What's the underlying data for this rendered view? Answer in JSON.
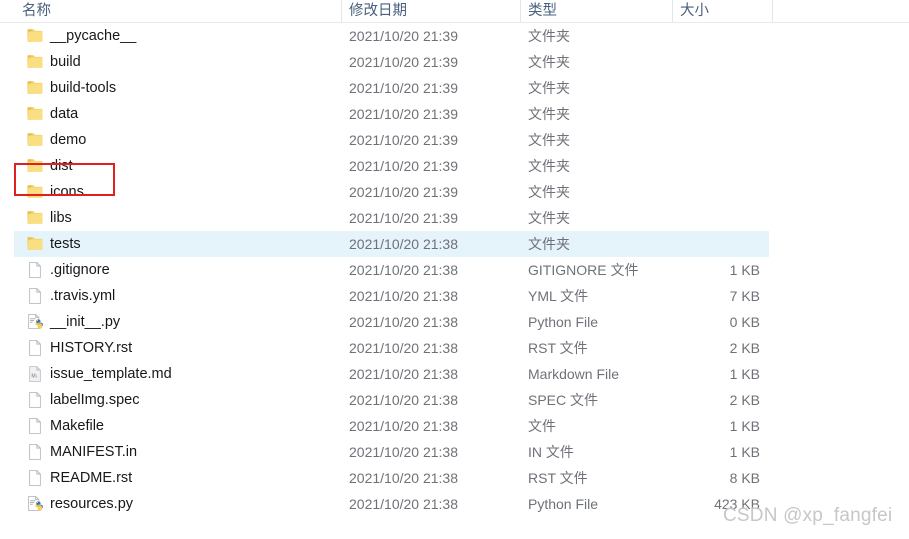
{
  "window": {
    "kind": "file-explorer-list-view",
    "language": "zh-CN"
  },
  "columns": [
    {
      "key": "name",
      "label": "名称"
    },
    {
      "key": "date",
      "label": "修改日期"
    },
    {
      "key": "type",
      "label": "类型"
    },
    {
      "key": "size",
      "label": "大小"
    }
  ],
  "rows": [
    {
      "name": "__pycache__",
      "date": "2021/10/20 21:39",
      "type": "文件夹",
      "size": "",
      "icon": "folder-icon",
      "selected": false
    },
    {
      "name": "build",
      "date": "2021/10/20 21:39",
      "type": "文件夹",
      "size": "",
      "icon": "folder-icon",
      "selected": false
    },
    {
      "name": "build-tools",
      "date": "2021/10/20 21:39",
      "type": "文件夹",
      "size": "",
      "icon": "folder-icon",
      "selected": false
    },
    {
      "name": "data",
      "date": "2021/10/20 21:39",
      "type": "文件夹",
      "size": "",
      "icon": "folder-icon",
      "selected": false
    },
    {
      "name": "demo",
      "date": "2021/10/20 21:39",
      "type": "文件夹",
      "size": "",
      "icon": "folder-icon",
      "selected": false
    },
    {
      "name": "dist",
      "date": "2021/10/20 21:39",
      "type": "文件夹",
      "size": "",
      "icon": "folder-icon",
      "selected": false
    },
    {
      "name": "icons",
      "date": "2021/10/20 21:39",
      "type": "文件夹",
      "size": "",
      "icon": "folder-icon",
      "selected": false
    },
    {
      "name": "libs",
      "date": "2021/10/20 21:39",
      "type": "文件夹",
      "size": "",
      "icon": "folder-icon",
      "selected": false
    },
    {
      "name": "tests",
      "date": "2021/10/20 21:38",
      "type": "文件夹",
      "size": "",
      "icon": "folder-icon",
      "selected": true
    },
    {
      "name": ".gitignore",
      "date": "2021/10/20 21:38",
      "type": "GITIGNORE 文件",
      "size": "1 KB",
      "icon": "file-icon",
      "selected": false
    },
    {
      "name": ".travis.yml",
      "date": "2021/10/20 21:38",
      "type": "YML 文件",
      "size": "7 KB",
      "icon": "file-icon",
      "selected": false
    },
    {
      "name": "__init__.py",
      "date": "2021/10/20 21:38",
      "type": "Python File",
      "size": "0 KB",
      "icon": "python-icon",
      "selected": false
    },
    {
      "name": "HISTORY.rst",
      "date": "2021/10/20 21:38",
      "type": "RST 文件",
      "size": "2 KB",
      "icon": "file-icon",
      "selected": false
    },
    {
      "name": "issue_template.md",
      "date": "2021/10/20 21:38",
      "type": "Markdown File",
      "size": "1 KB",
      "icon": "markdown-icon",
      "selected": false
    },
    {
      "name": "labelImg.spec",
      "date": "2021/10/20 21:38",
      "type": "SPEC 文件",
      "size": "2 KB",
      "icon": "file-icon",
      "selected": false
    },
    {
      "name": "Makefile",
      "date": "2021/10/20 21:38",
      "type": "文件",
      "size": "1 KB",
      "icon": "file-icon",
      "selected": false
    },
    {
      "name": "MANIFEST.in",
      "date": "2021/10/20 21:38",
      "type": "IN 文件",
      "size": "1 KB",
      "icon": "file-icon",
      "selected": false
    },
    {
      "name": "README.rst",
      "date": "2021/10/20 21:38",
      "type": "RST 文件",
      "size": "8 KB",
      "icon": "file-icon",
      "selected": false
    },
    {
      "name": "resources.py",
      "date": "2021/10/20 21:38",
      "type": "Python File",
      "size": "423 KB",
      "icon": "python-icon",
      "selected": false
    }
  ],
  "annotation": {
    "target_row_name": "dist",
    "shape": "rectangle",
    "color": "#e02020"
  },
  "watermark": {
    "text": "CSDN @xp_fangfei",
    "color": "#c7c7c7"
  },
  "colors": {
    "header_text": "#4a6080",
    "row_text": "#17181a",
    "meta_text": "#6e7278",
    "selection": "#e5f3fb",
    "folder": "#f7d676",
    "divider": "#e2e5e9"
  }
}
